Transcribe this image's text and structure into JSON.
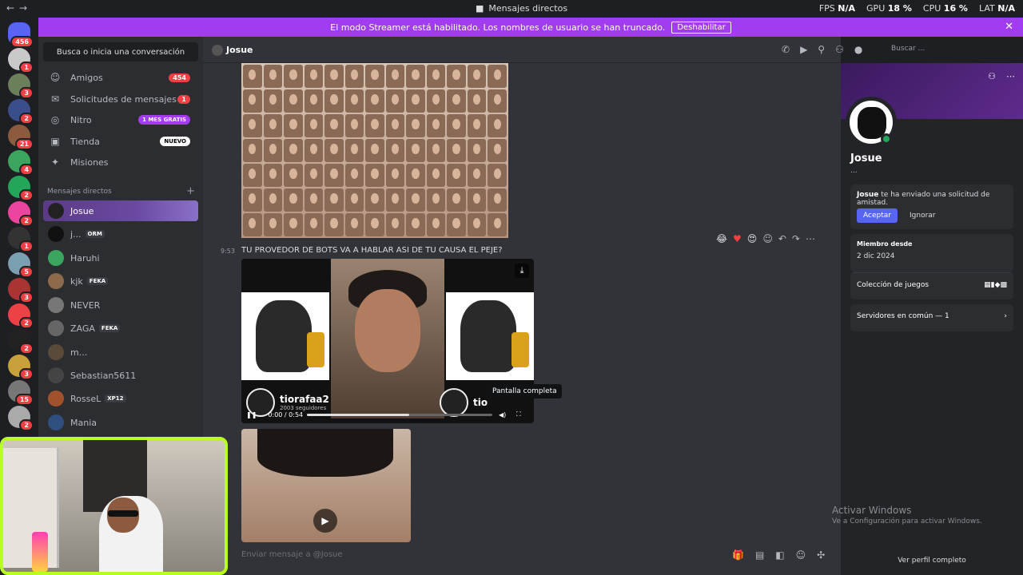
{
  "titlebar": {
    "title": "Mensajes directos",
    "fps_label": "FPS",
    "fps": "N/A",
    "gpu_label": "GPU",
    "gpu": "18 %",
    "cpu_label": "CPU",
    "cpu": "16 %",
    "lat_label": "LAT",
    "lat": "N/A"
  },
  "banner": {
    "text": "El modo Streamer está habilitado. Los nombres de usuario se han truncado.",
    "button": "Deshabilitar"
  },
  "guilds": {
    "home_badge": "456",
    "badges": [
      "1",
      "3",
      "2",
      "21",
      "4",
      "2",
      "2",
      "1",
      "5",
      "3",
      "2",
      "2",
      "3",
      "15",
      "2"
    ]
  },
  "sidebar": {
    "search": "Busca o inicia una conversación",
    "items": [
      {
        "label": "Amigos",
        "count": "454"
      },
      {
        "label": "Solicitudes de mensajes",
        "count": "1"
      },
      {
        "label": "Nitro",
        "tag": "1 MES GRATIS"
      },
      {
        "label": "Tienda",
        "tag": "NUEVO"
      },
      {
        "label": "Misiones"
      }
    ],
    "dm_header": "Mensajes directos",
    "dms": [
      {
        "name": "Josue"
      },
      {
        "name": "j...",
        "tag": "ORM"
      },
      {
        "name": "Haruhi"
      },
      {
        "name": "kjk",
        "tag": "FEKA"
      },
      {
        "name": "NEVER"
      },
      {
        "name": "ZAGA",
        "tag": "FEKA"
      },
      {
        "name": "m..."
      },
      {
        "name": "Sebastian5611"
      },
      {
        "name": "RosseL",
        "tag": "XP12"
      },
      {
        "name": "Mania"
      }
    ]
  },
  "header": {
    "name": "Josue",
    "search_placeholder": "Buscar ..."
  },
  "chat": {
    "time": "9:53",
    "message": "TU PROVEDOR DE BOTS VA A HABLAR ASI DE TU CAUSA EL PEJE?",
    "video": {
      "profile": "tiorafaa2",
      "profile_short": "tio",
      "followers": "2003 seguidores",
      "time": "0:00 / 0:54",
      "progress": 0.55
    },
    "tooltip": "Pantalla completa"
  },
  "composer": {
    "placeholder": "Enviar mensaje a @Josue"
  },
  "profile": {
    "name": "Josue",
    "sub": "...",
    "request_name": "Josue",
    "request_text": " te ha enviado una solicitud de amistad.",
    "accept": "Aceptar",
    "ignore": "Ignorar",
    "member_label": "Miembro desde",
    "member_value": "2 dic 2024",
    "games_label": "Colección de juegos",
    "servers_label": "Servidores en común — 1",
    "view_full": "Ver perfil completo"
  },
  "windows": {
    "line1": "Activar Windows",
    "line2": "Ve a Configuración para activar Windows."
  }
}
